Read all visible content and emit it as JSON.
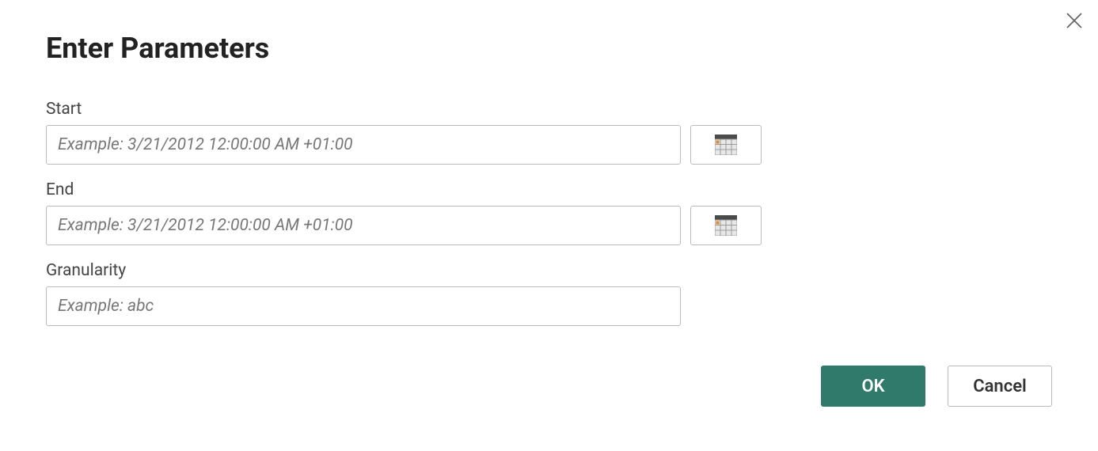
{
  "dialog": {
    "title": "Enter Parameters",
    "close_label": "Close"
  },
  "fields": {
    "start": {
      "label": "Start",
      "placeholder": "Example: 3/21/2012 12:00:00 AM +01:00",
      "value": ""
    },
    "end": {
      "label": "End",
      "placeholder": "Example: 3/21/2012 12:00:00 AM +01:00",
      "value": ""
    },
    "granularity": {
      "label": "Granularity",
      "placeholder": "Example: abc",
      "value": ""
    }
  },
  "buttons": {
    "ok": "OK",
    "cancel": "Cancel"
  }
}
